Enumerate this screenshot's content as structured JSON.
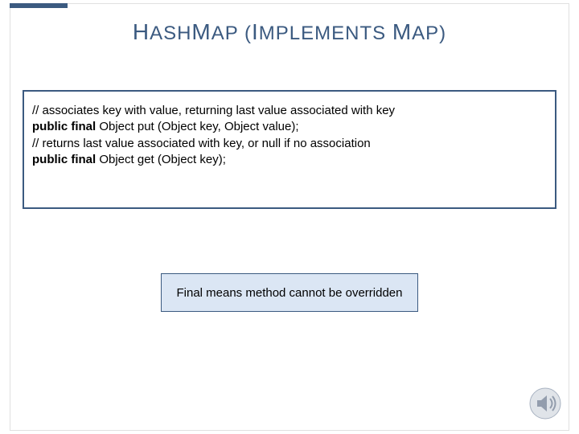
{
  "title": {
    "h1": "H",
    "ash": "ASH",
    "m1": "M",
    "ap1": "AP",
    "open": " (",
    "i": "I",
    "mplements": "MPLEMENTS ",
    "m2": "M",
    "ap2": "AP",
    "close": ")"
  },
  "code": {
    "line1_comment": "// associates key with value, returning last value associated with key",
    "line2_kw": "public final",
    "line2_rest": " Object put (Object key, Object value);",
    "line3_comment": "// returns last value associated with key, or null if no association",
    "line4_kw": "public final",
    "line4_rest": " Object get (Object key);"
  },
  "note": "Final means method cannot be overridden",
  "icons": {
    "speaker": "speaker-icon"
  }
}
